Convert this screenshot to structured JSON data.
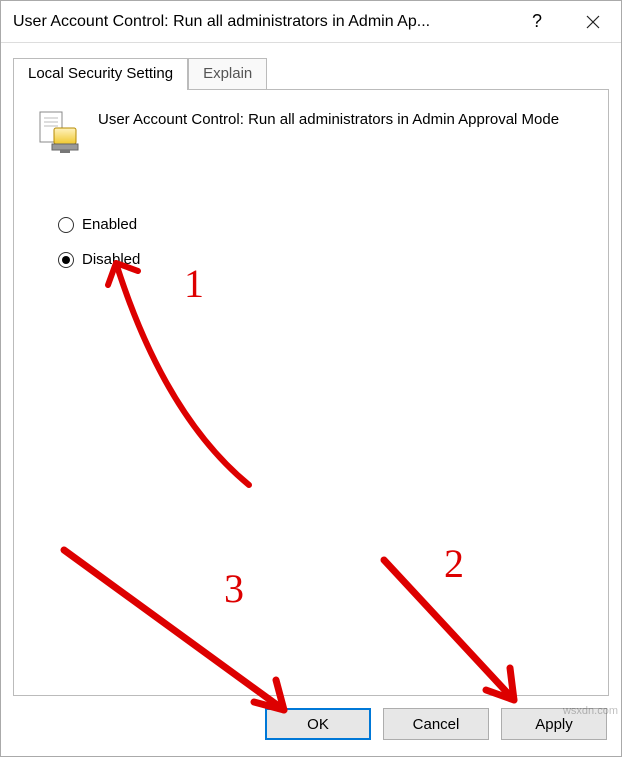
{
  "titlebar": {
    "title": "User Account Control: Run all administrators in Admin Ap..."
  },
  "tabs": {
    "active": "Local Security Setting",
    "items": [
      "Local Security Setting",
      "Explain"
    ]
  },
  "setting": {
    "title": "User Account Control: Run all administrators in Admin Approval Mode"
  },
  "radios": {
    "enabled_label": "Enabled",
    "disabled_label": "Disabled",
    "selected": "Disabled"
  },
  "buttons": {
    "ok": "OK",
    "cancel": "Cancel",
    "apply": "Apply"
  },
  "annotations": {
    "n1": "1",
    "n2": "2",
    "n3": "3"
  },
  "watermark": "wsxdn.com"
}
